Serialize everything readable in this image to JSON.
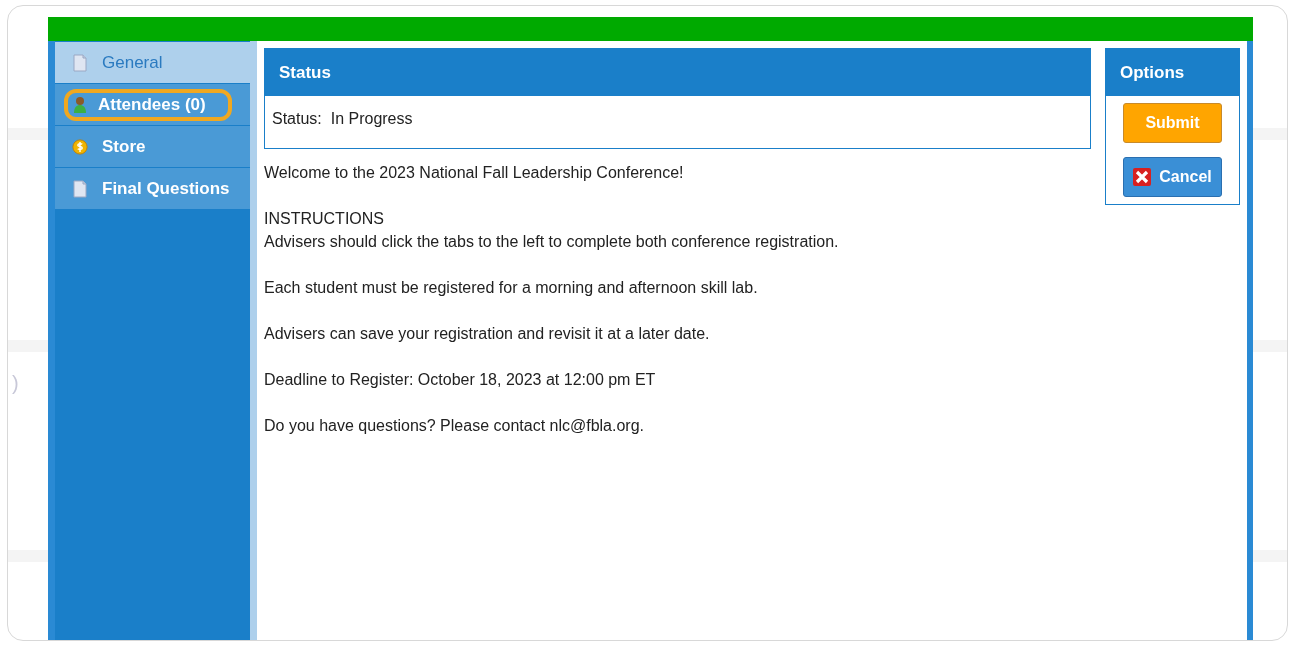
{
  "background_fragment": ")",
  "tabs": [
    {
      "label": "General",
      "kind": "page",
      "selected": true,
      "highlighted": false
    },
    {
      "label": "Attendees (0)",
      "kind": "person",
      "selected": false,
      "highlighted": true
    },
    {
      "label": "Store",
      "kind": "coin",
      "selected": false,
      "highlighted": false
    },
    {
      "label": "Final Questions",
      "kind": "page",
      "selected": false,
      "highlighted": false
    }
  ],
  "status": {
    "header": "Status",
    "label": "Status:",
    "value": "In Progress"
  },
  "paragraphs": [
    [
      "Welcome to the 2023 National Fall Leadership Conference!"
    ],
    [
      "INSTRUCTIONS",
      "Advisers should click the tabs to the left to complete both conference registration."
    ],
    [
      "Each student must be registered for a morning and afternoon skill lab."
    ],
    [
      "Advisers can save your registration and revisit it at a later date."
    ],
    [
      "Deadline to Register: October 18, 2023 at 12:00 pm ET"
    ],
    [
      "Do you have questions? Please contact nlc@fbla.org."
    ]
  ],
  "options": {
    "header": "Options",
    "buttons": [
      {
        "label": "Submit",
        "kind": "submit"
      },
      {
        "label": "Cancel",
        "kind": "cancel"
      }
    ]
  }
}
